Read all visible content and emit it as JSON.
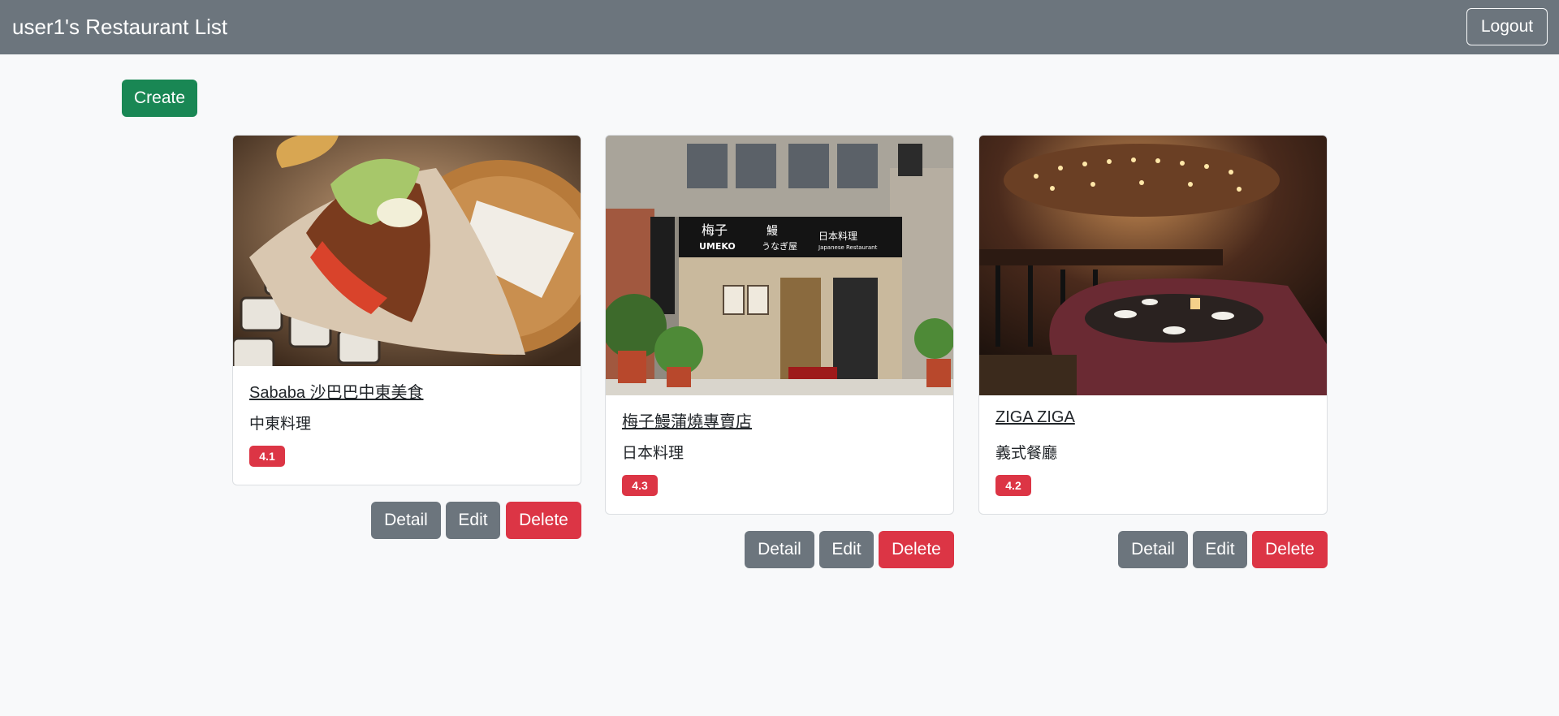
{
  "navbar": {
    "title": "user1's Restaurant List",
    "logout_label": "Logout"
  },
  "toolbar": {
    "create_label": "Create"
  },
  "restaurants": [
    {
      "name": "Sababa 沙巴巴中東美食",
      "category": "中東料理",
      "rating": "4.1"
    },
    {
      "name": "梅子鰻蒲燒專賣店",
      "category": "日本料理",
      "rating": "4.3"
    },
    {
      "name": "ZIGA ZIGA",
      "category": "義式餐廳",
      "rating": "4.2"
    }
  ],
  "actions": {
    "detail_label": "Detail",
    "edit_label": "Edit",
    "delete_label": "Delete"
  },
  "sign": {
    "title": "梅子",
    "sub": "UMEKO",
    "eel": "鰻",
    "kana": "うなぎ屋",
    "right": "日本料理",
    "right_sub": "Japanese Restaurant"
  },
  "colors": {
    "navbar": "#6c757d",
    "create": "#198754",
    "badge": "#dc3545",
    "delete": "#dc3545",
    "secondary": "#6c757d"
  }
}
